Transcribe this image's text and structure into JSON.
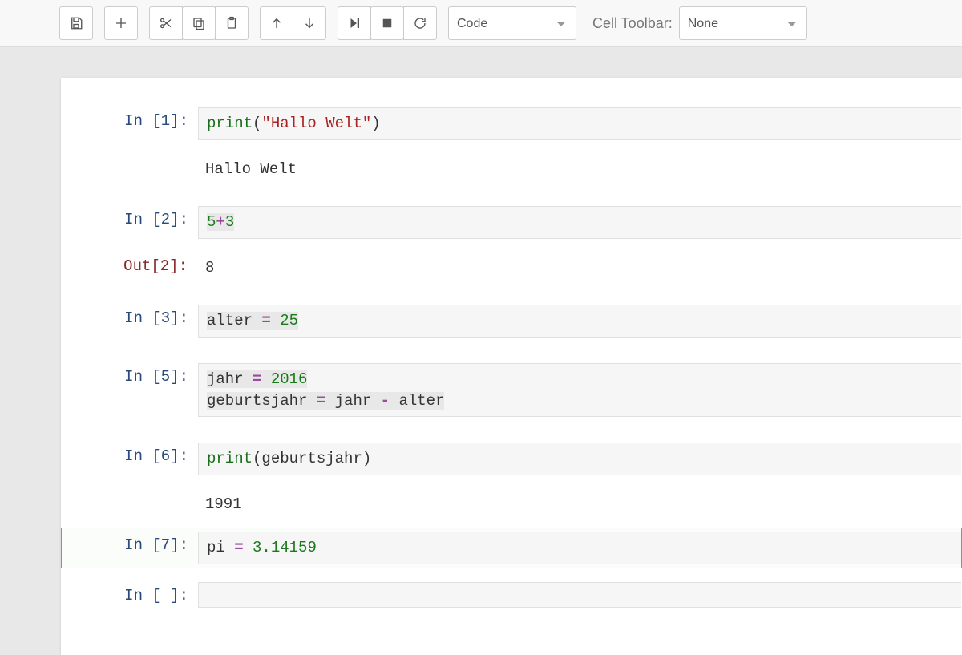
{
  "toolbar": {
    "cell_type_value": "Code",
    "cell_toolbar_label": "Cell Toolbar:",
    "cell_toolbar_value": "None"
  },
  "cells": [
    {
      "in_prompt": "In [1]:",
      "code_parts": {
        "func1": "print",
        "paren1": "(",
        "str1": "\"Hallo Welt\"",
        "paren2": ")"
      },
      "stdout": "Hallo Welt"
    },
    {
      "in_prompt": "In [2]:",
      "code_parts": {
        "num1": "5",
        "op1": "+",
        "num2": "3"
      },
      "out_prompt": "Out[2]:",
      "out_value": "8"
    },
    {
      "in_prompt": "In [3]:",
      "code_parts": {
        "name1": "alter ",
        "op1": "=",
        "sp1": " ",
        "num1": "25"
      }
    },
    {
      "in_prompt": "In [5]:",
      "line1": {
        "name1": "jahr ",
        "op1": "=",
        "sp1": " ",
        "num1": "2016"
      },
      "line2": {
        "name1": "geburtsjahr ",
        "op1": "=",
        "sp1": " jahr ",
        "op2": "-",
        "sp2": " alter"
      }
    },
    {
      "in_prompt": "In [6]:",
      "code_parts": {
        "func1": "print",
        "paren1": "(",
        "name1": "geburtsjahr",
        "paren2": ")"
      },
      "stdout": "1991"
    },
    {
      "in_prompt": "In [7]:",
      "code_parts": {
        "name1": "pi ",
        "op1": "=",
        "sp1": " ",
        "num1": "3.14159"
      }
    },
    {
      "in_prompt": "In [ ]:"
    }
  ]
}
